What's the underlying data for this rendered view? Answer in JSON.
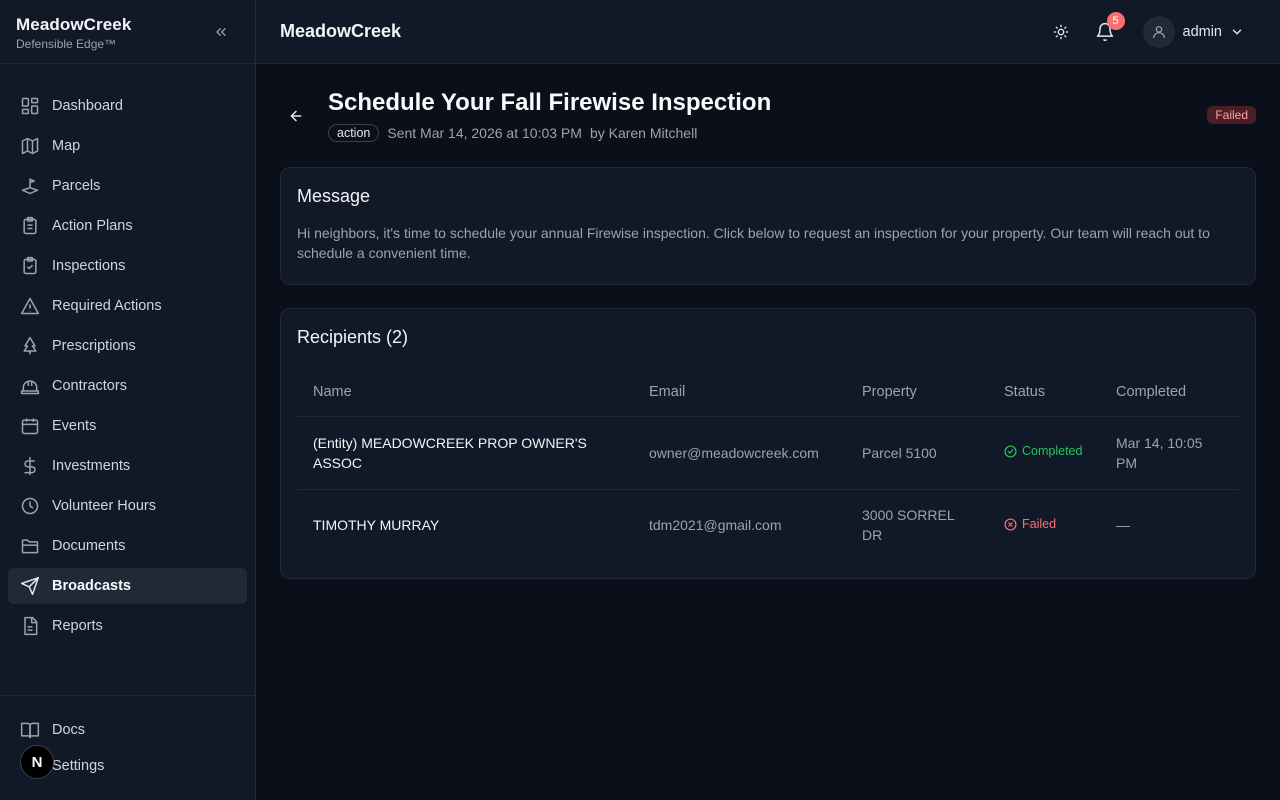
{
  "brand": {
    "name": "MeadowCreek",
    "tagline": "Defensible Edge™"
  },
  "sidebar": {
    "items": [
      {
        "label": "Dashboard",
        "icon": "dashboard-icon"
      },
      {
        "label": "Map",
        "icon": "map-icon"
      },
      {
        "label": "Parcels",
        "icon": "parcels-icon"
      },
      {
        "label": "Action Plans",
        "icon": "clipboard-icon"
      },
      {
        "label": "Inspections",
        "icon": "clipboard-check-icon"
      },
      {
        "label": "Required Actions",
        "icon": "warning-icon"
      },
      {
        "label": "Prescriptions",
        "icon": "tree-icon"
      },
      {
        "label": "Contractors",
        "icon": "hardhat-icon"
      },
      {
        "label": "Events",
        "icon": "calendar-icon"
      },
      {
        "label": "Investments",
        "icon": "dollar-icon"
      },
      {
        "label": "Volunteer Hours",
        "icon": "clock-icon"
      },
      {
        "label": "Documents",
        "icon": "folder-icon"
      },
      {
        "label": "Broadcasts",
        "icon": "send-icon",
        "active": true
      },
      {
        "label": "Reports",
        "icon": "report-icon"
      }
    ],
    "bottom": [
      {
        "label": "Docs",
        "icon": "book-icon"
      },
      {
        "label": "Settings",
        "icon": "gear-icon"
      }
    ],
    "n_badge": "N"
  },
  "header": {
    "title": "MeadowCreek",
    "notifications": "5",
    "user": "admin"
  },
  "page": {
    "title": "Schedule Your Fall Firewise Inspection",
    "tag": "action",
    "sent": "Sent Mar 14, 2026 at 10:03 PM",
    "by": "by Karen Mitchell",
    "status": "Failed"
  },
  "message": {
    "title": "Message",
    "body": "Hi neighbors, it's time to schedule your annual Firewise inspection. Click below to request an inspection for your property. Our team will reach out to schedule a convenient time."
  },
  "recipients": {
    "title": "Recipients (2)",
    "columns": [
      "Name",
      "Email",
      "Property",
      "Status",
      "Completed"
    ],
    "rows": [
      {
        "name": "(Entity) MEADOWCREEK PROP OWNER'S ASSOC",
        "email": "owner@meadowcreek.com",
        "property": "Parcel 5100",
        "status": "Completed",
        "completed": "Mar 14, 10:05 PM"
      },
      {
        "name": "TIMOTHY MURRAY",
        "email": "tdm2021@gmail.com",
        "property": "3000 SORREL DR",
        "status": "Failed",
        "completed": "—"
      }
    ]
  },
  "colors": {
    "background": "#0b0f19",
    "panel": "#111827",
    "success": "#22c55e",
    "danger": "#f87171"
  }
}
